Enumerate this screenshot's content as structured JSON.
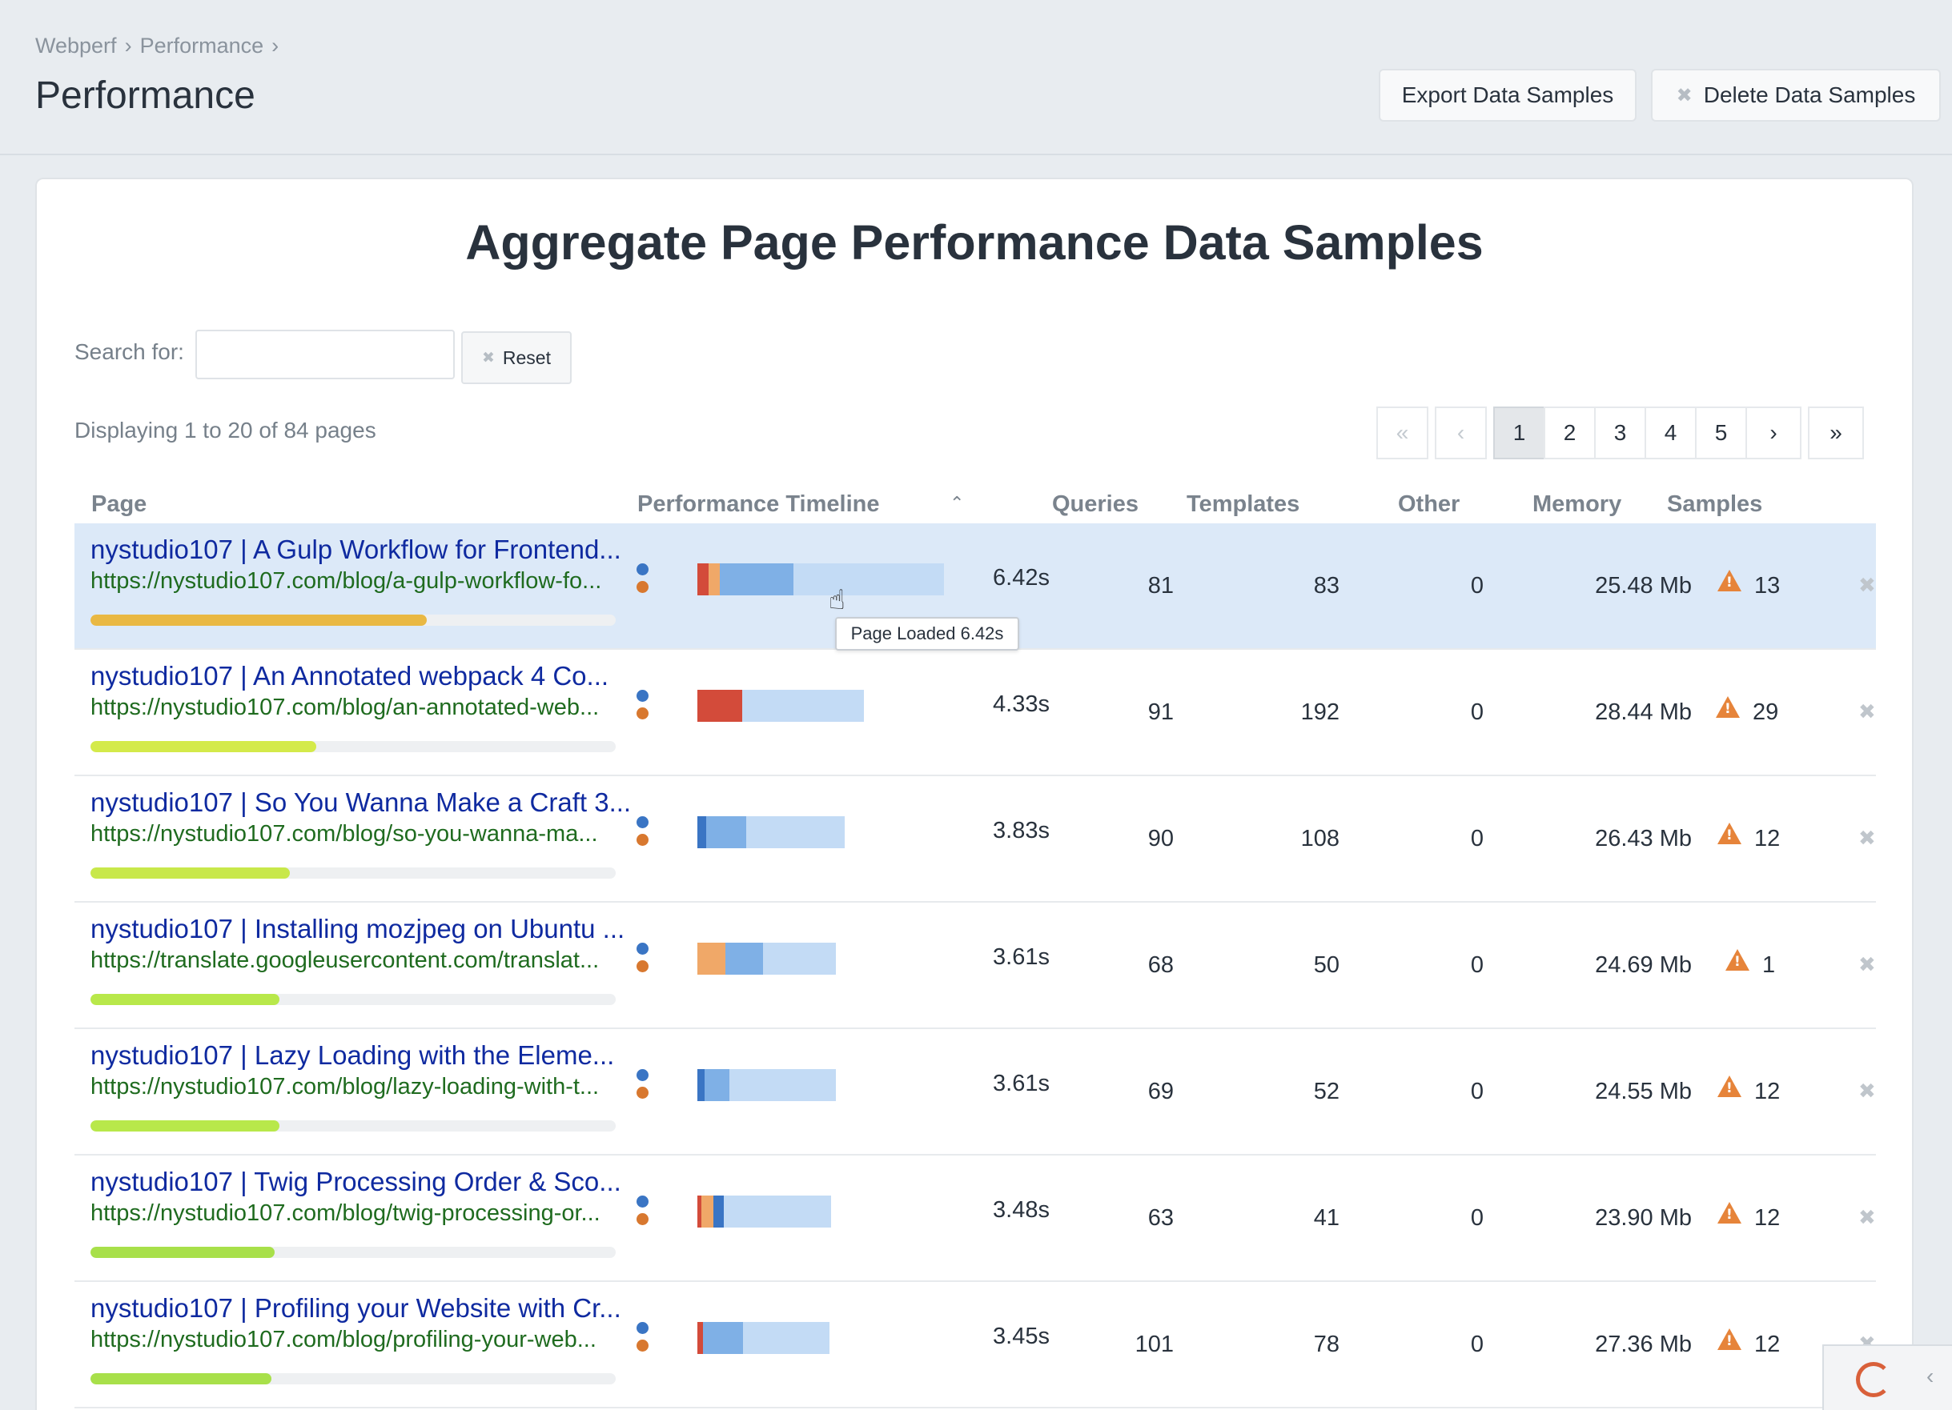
{
  "breadcrumb": [
    "Webperf",
    "Performance"
  ],
  "page_title": "Performance",
  "buttons": {
    "export": "Export Data Samples",
    "delete": "Delete Data Samples"
  },
  "card_title": "Aggregate Page Performance Data Samples",
  "search": {
    "label": "Search for:",
    "value": "",
    "reset": "Reset"
  },
  "displaying": "Displaying 1 to 20 of 84 pages",
  "pagination": [
    "«",
    "‹",
    "1",
    "2",
    "3",
    "4",
    "5",
    "›",
    "»"
  ],
  "columns": {
    "page": "Page",
    "timeline": "Performance Timeline",
    "queries": "Queries",
    "templates": "Templates",
    "other": "Other",
    "memory": "Memory",
    "samples": "Samples"
  },
  "colors": {
    "red": "#d34b3a",
    "orange": "#f0a868",
    "blue": "#7fb0e6",
    "darkblue": "#3a75c4",
    "light": "#c3dbf5",
    "yellow": "#e9b843",
    "lime": "#c8e84a"
  },
  "rows": [
    {
      "title": "nystudio107 | A Gulp Workflow for Frontend...",
      "url": "https://nystudio107.com/blog/a-gulp-workflow-fo...",
      "time": "6.42s",
      "queries": "81",
      "templates": "83",
      "other": "0",
      "memory": "25.48 Mb",
      "samples": "13",
      "progress": 0.64,
      "progress_color": "#e9b843",
      "highlight": true,
      "segments": [
        [
          "red",
          0.045
        ],
        [
          "orange",
          0.045
        ],
        [
          "blue",
          0.3
        ],
        [
          "light",
          0.61
        ]
      ],
      "timeline_fraction": 1.0
    },
    {
      "title": "nystudio107 | An Annotated webpack 4 Co...",
      "url": "https://nystudio107.com/blog/an-annotated-web...",
      "time": "4.33s",
      "queries": "91",
      "templates": "192",
      "other": "0",
      "memory": "28.44 Mb",
      "samples": "29",
      "progress": 0.43,
      "progress_color": "#d4ea4a",
      "segments": [
        [
          "red",
          0.27
        ],
        [
          "light",
          0.73
        ]
      ],
      "timeline_fraction": 0.674
    },
    {
      "title": "nystudio107 | So You Wanna Make a Craft 3...",
      "url": "https://nystudio107.com/blog/so-you-wanna-ma...",
      "time": "3.83s",
      "queries": "90",
      "templates": "108",
      "other": "0",
      "memory": "26.43 Mb",
      "samples": "12",
      "progress": 0.38,
      "progress_color": "#c8e84a",
      "segments": [
        [
          "darkblue",
          0.06
        ],
        [
          "blue",
          0.27
        ],
        [
          "light",
          0.67
        ]
      ],
      "timeline_fraction": 0.597
    },
    {
      "title": "nystudio107 | Installing mozjpeg on Ubuntu ...",
      "url": "https://translate.googleusercontent.com/translat...",
      "time": "3.61s",
      "queries": "68",
      "templates": "50",
      "other": "0",
      "memory": "24.69 Mb",
      "samples": "1",
      "progress": 0.36,
      "progress_color": "#b8e84a",
      "segments": [
        [
          "orange",
          0.2
        ],
        [
          "blue",
          0.27
        ],
        [
          "light",
          0.53
        ]
      ],
      "timeline_fraction": 0.563
    },
    {
      "title": "nystudio107 | Lazy Loading with the Eleme...",
      "url": "https://nystudio107.com/blog/lazy-loading-with-t...",
      "time": "3.61s",
      "queries": "69",
      "templates": "52",
      "other": "0",
      "memory": "24.55 Mb",
      "samples": "12",
      "progress": 0.36,
      "progress_color": "#b8e84a",
      "segments": [
        [
          "darkblue",
          0.05
        ],
        [
          "blue",
          0.18
        ],
        [
          "light",
          0.77
        ]
      ],
      "timeline_fraction": 0.563
    },
    {
      "title": "nystudio107 | Twig Processing Order & Sco...",
      "url": "https://nystudio107.com/blog/twig-processing-or...",
      "time": "3.48s",
      "queries": "63",
      "templates": "41",
      "other": "0",
      "memory": "23.90 Mb",
      "samples": "12",
      "progress": 0.35,
      "progress_color": "#a8e04a",
      "segments": [
        [
          "red",
          0.03
        ],
        [
          "orange",
          0.09
        ],
        [
          "darkblue",
          0.08
        ],
        [
          "light",
          0.8
        ]
      ],
      "timeline_fraction": 0.542
    },
    {
      "title": "nystudio107 | Profiling your Website with Cr...",
      "url": "https://nystudio107.com/blog/profiling-your-web...",
      "time": "3.45s",
      "queries": "101",
      "templates": "78",
      "other": "0",
      "memory": "27.36 Mb",
      "samples": "12",
      "progress": 0.345,
      "progress_color": "#a8e04a",
      "segments": [
        [
          "red",
          0.04
        ],
        [
          "blue",
          0.3
        ],
        [
          "light",
          0.66
        ]
      ],
      "timeline_fraction": 0.537
    }
  ],
  "tooltip": "Page Loaded 6.42s"
}
